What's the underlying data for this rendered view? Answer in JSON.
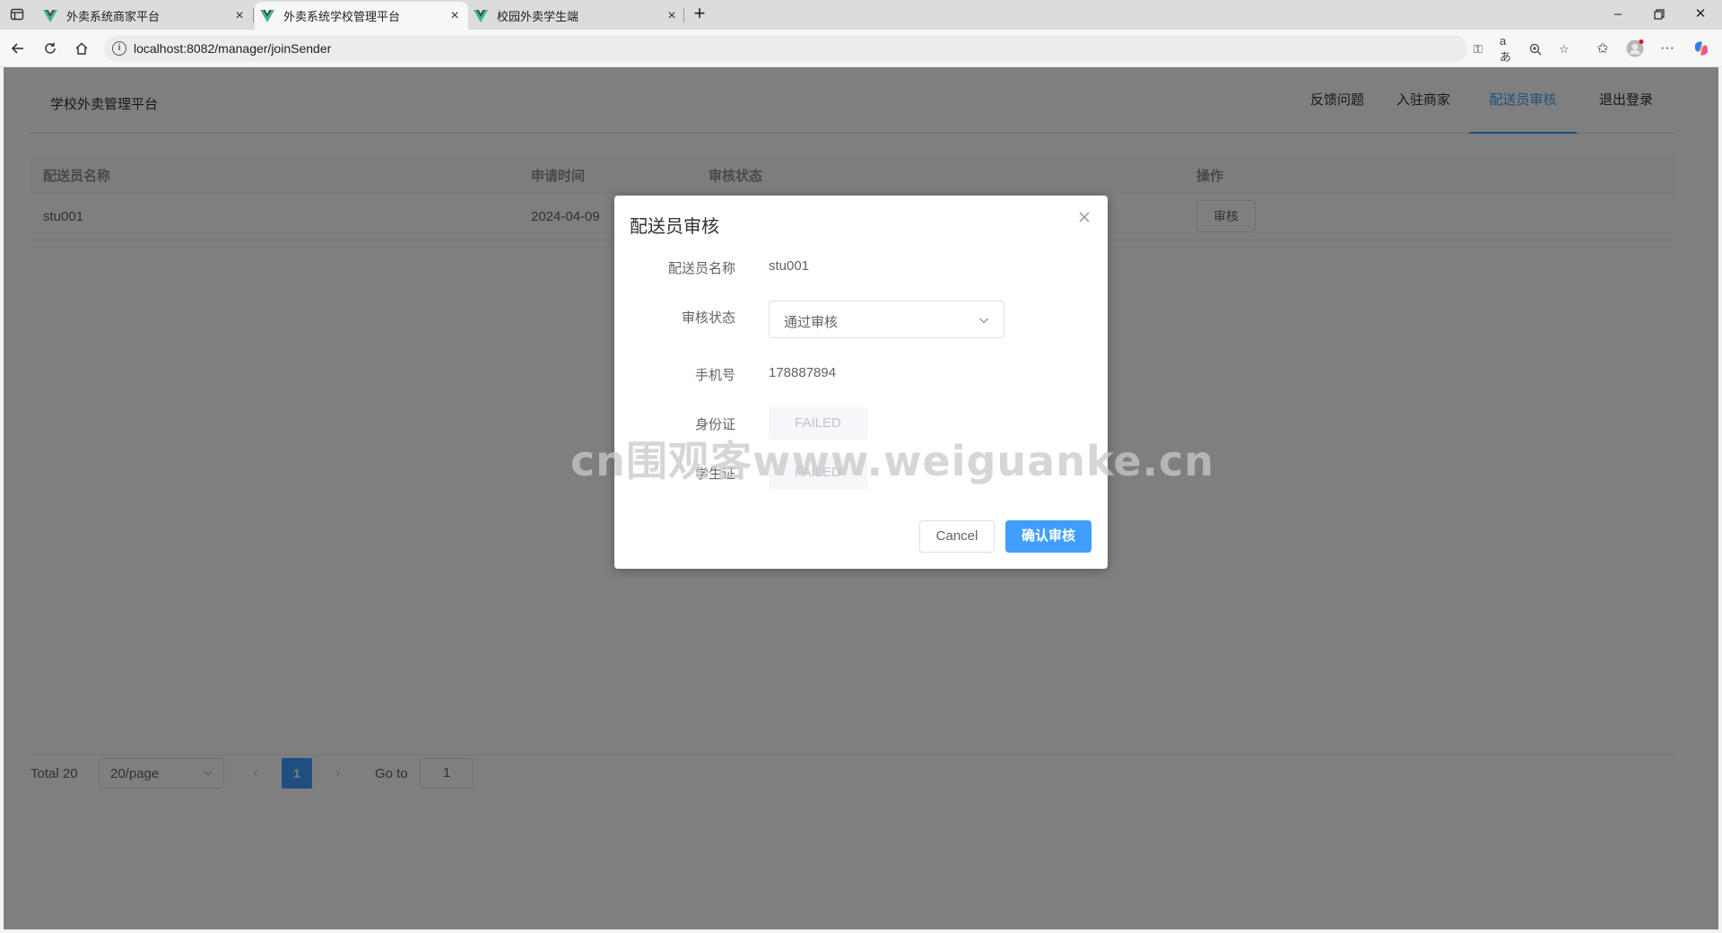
{
  "browser": {
    "tabs": [
      {
        "title": "外卖系统商家平台",
        "active": false
      },
      {
        "title": "外卖系统学校管理平台",
        "active": true
      },
      {
        "title": "校园外卖学生端",
        "active": false
      }
    ],
    "url": "localhost:8082/manager/joinSender"
  },
  "header": {
    "brand": "学校外卖管理平台",
    "menu": [
      "反馈问题",
      "入驻商家",
      "配送员审核",
      "退出登录"
    ],
    "active_menu": "配送员审核"
  },
  "table": {
    "columns": [
      "配送员名称",
      "申请时间",
      "审核状态",
      "操作"
    ],
    "rows": [
      {
        "name": "stu001",
        "time": "2024-04-09",
        "status": "",
        "action": "审核"
      }
    ]
  },
  "pagination": {
    "total": "Total 20",
    "page_size": "20/page",
    "prev": "‹",
    "current": "1",
    "next": "›",
    "goto_label": "Go to",
    "goto_value": "1"
  },
  "dialog": {
    "title": "配送员审核",
    "name_label": "配送员名称",
    "name_value": "stu001",
    "status_label": "审核状态",
    "status_value": "通过审核",
    "phone_label": "手机号",
    "phone_value": "178887894",
    "idcard_label": "身份证",
    "idcard_value": "FAILED",
    "student_card_label": "学生证",
    "student_card_value": "FAILED",
    "cancel_label": "Cancel",
    "confirm_label": "确认审核"
  },
  "watermark": "cn围观客www.weiguanke.cn",
  "colors": {
    "primary": "#409eff",
    "overlay": "rgba(0,0,0,0.5)"
  }
}
